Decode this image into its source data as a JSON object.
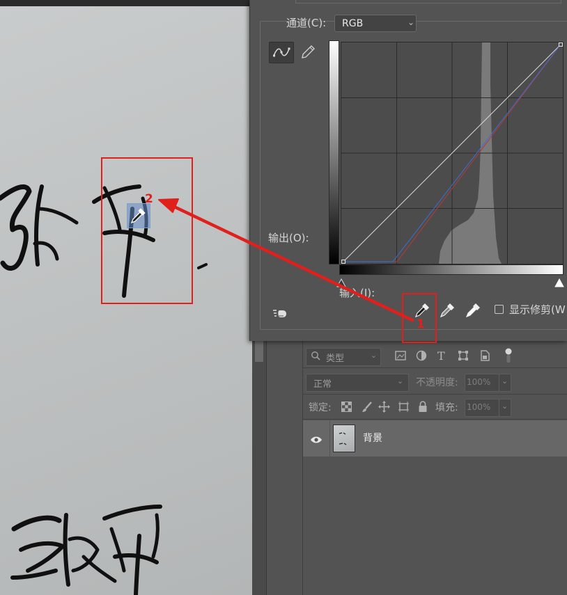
{
  "dialog": {
    "channel_label": "通道(C):",
    "channel_value": "RGB",
    "output_label": "输出(O):",
    "input_label": "输入(I):",
    "show_clipping_label": "显示修剪(W",
    "tools": [
      "curve-point-tool",
      "pencil-draw-tool",
      "auto-adjust-tool"
    ],
    "eyedroppers": [
      "black-point-eyedropper",
      "gray-point-eyedropper",
      "white-point-eyedropper"
    ]
  },
  "layers_panel": {
    "filter_type_placeholder": "类型",
    "blend_mode": "正常",
    "opacity_label": "不透明度:",
    "opacity_value": "100%",
    "lock_label": "锁定:",
    "fill_label": "填充:",
    "fill_value": "100%",
    "layers": [
      {
        "name": "背景",
        "visible": true
      }
    ]
  },
  "annotations": {
    "marker_1": "1",
    "marker_2": "2",
    "color": "#e0201c"
  },
  "colors": {
    "panel_bg": "#535353",
    "curve_blue": "#3a6fd8",
    "curve_red": "#c0392b"
  }
}
